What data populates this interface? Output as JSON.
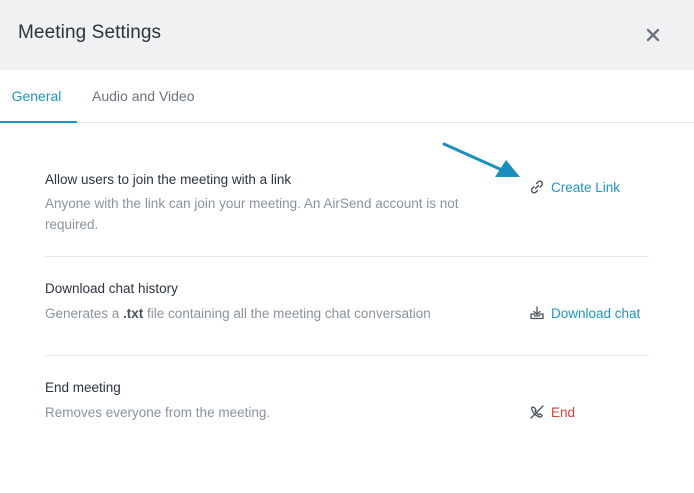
{
  "dialog": {
    "title": "Meeting Settings",
    "close_icon": "close-icon"
  },
  "tabs": [
    {
      "label": "General",
      "active": true
    },
    {
      "label": "Audio and Video",
      "active": false
    }
  ],
  "settings": {
    "link": {
      "title": "Allow users to join the meeting with a link",
      "description": "Anyone with the link can join your meeting. An AirSend account is not required.",
      "action_label": "Create Link",
      "action_icon": "link-icon"
    },
    "download": {
      "title": "Download chat history",
      "description_prefix": "Generates a ",
      "description_bold": ".txt",
      "description_suffix": " file containing all the meeting chat conversation",
      "action_label": "Download chat",
      "action_icon": "download-icon"
    },
    "end": {
      "title": "End meeting",
      "description": "Removes everyone from the meeting.",
      "action_label": "End",
      "action_icon": "end-call-icon"
    }
  },
  "colors": {
    "accent": "#1e96c0",
    "danger": "#d8413b",
    "header_bg": "#f0f1f3"
  },
  "annotation_icon": "pointer-arrow-icon"
}
